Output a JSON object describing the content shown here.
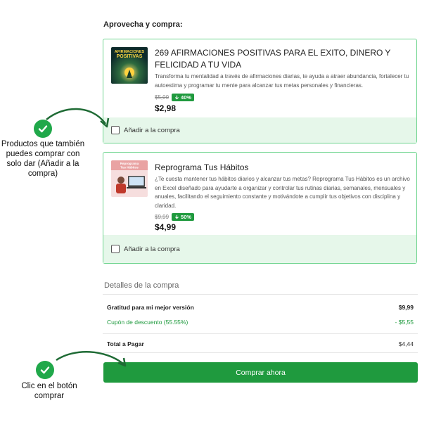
{
  "section_title": "Aprovecha y compra:",
  "products": [
    {
      "title": "269 AFIRMACIONES POSITIVAS PARA EL EXITO, DINERO Y FELICIDAD A TU VIDA",
      "thumb_text": "AFIRMACIONES POSITIVAS",
      "description": "Transforma tu mentalidad a través de afirmaciones diarias, te ayuda a atraer abundancia, fortalecer tu autoestima y programar tu mente para alcanzar tus metas personales y financieras.",
      "old_price": "$5,00",
      "discount": "40%",
      "price": "$2,98",
      "add_label": "Añadir a la compra"
    },
    {
      "title": "Reprograma Tus Hábitos",
      "thumb_text": "Reprograma Tus Hábitos",
      "description": "¿Te cuesta mantener tus hábitos diarios y alcanzar tus metas? Reprograma Tus Hábitos es un archivo en Excel diseñado para ayudarte a organizar y controlar tus rutinas diarias, semanales, mensuales y anuales, facilitando el seguimiento constante y motivándote a cumplir tus objetivos con disciplina y claridad.",
      "old_price": "$9,99",
      "discount": "50%",
      "price": "$4,99",
      "add_label": "Añadir a la compra"
    }
  ],
  "details": {
    "title": "Detalles de la compra",
    "rows": [
      {
        "label": "Gratitud para mi mejor versión",
        "value": "$9,99"
      },
      {
        "label": "Cupón de descuento (55.55%)",
        "value": "- $5,55"
      },
      {
        "label": "Total a Pagar",
        "value": "$4,44"
      }
    ]
  },
  "buy_button": "Comprar ahora",
  "annotations": {
    "note1": "Productos que también puedes comprar con solo dar (Añadir a la compra)",
    "note2": "Clic en el botón comprar"
  },
  "colors": {
    "accent": "#1f9a3e",
    "card_border": "#6fd58f",
    "add_row_bg": "#e6f7ea"
  }
}
